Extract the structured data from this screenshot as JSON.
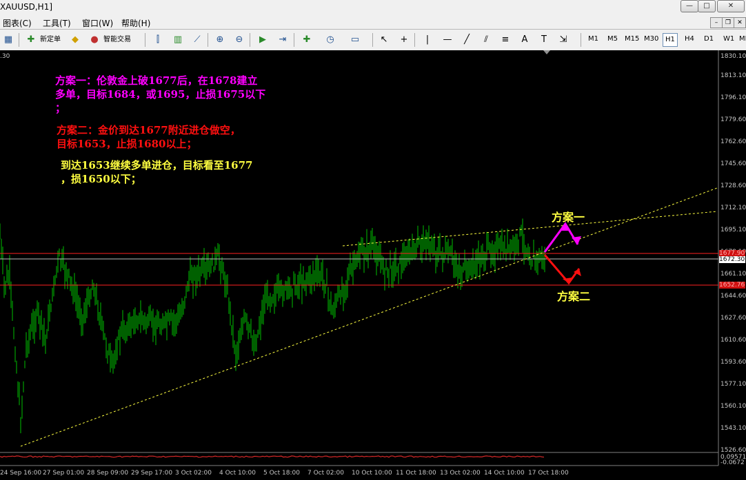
{
  "window": {
    "title": "XAUUSD,H1]"
  },
  "menu": [
    "图表(C)",
    "工具(T)",
    "窗口(W)",
    "帮助(H)"
  ],
  "toolbar": {
    "new_order": "新定单",
    "expert": "智能交易",
    "text_tool": "A",
    "label_tool": "T"
  },
  "timeframes": [
    "M1",
    "M5",
    "M15",
    "M30",
    "H1",
    "H4",
    "D1",
    "W1",
    "MN"
  ],
  "active_timeframe": "H1",
  "chart": {
    "top_left_value": ".30",
    "notes": [
      {
        "text": "方案一：伦敦金上破1677后，在1678建立\n多单，目标1684，或1695，止损1675以下\n；",
        "color": "#ff00ff"
      },
      {
        "text": "方案二：金价到达1677附近进仓做空，\n目标1653，止损1680以上；",
        "color": "#ff1010"
      },
      {
        "text": "到达1653继续多单进仓，目标看至1677\n，损1650以下；",
        "color": "#ffff40"
      }
    ],
    "plan_labels": {
      "plan1": "方案一",
      "plan2": "方案二"
    },
    "price_axis": [
      "1830.10",
      "1813.10",
      "1796.10",
      "1779.60",
      "1762.60",
      "1745.60",
      "1728.60",
      "1712.10",
      "1695.10",
      "1678.10",
      "1661.10",
      "1644.60",
      "1627.60",
      "1610.60",
      "1593.60",
      "1577.10",
      "1560.10",
      "1543.10",
      "1526.60"
    ],
    "price_markers": [
      {
        "value": "1677.90",
        "bg": "#d01010",
        "fg": "#ffb0b0"
      },
      {
        "value": "1672.30",
        "bg": "#ffffff",
        "fg": "#000000"
      },
      {
        "value": "1652.76",
        "bg": "#d01010",
        "fg": "#ffb0b0"
      }
    ],
    "indicator_values": [
      "0.09571",
      "-0.0672"
    ],
    "time_axis": [
      "24 Sep 16:00",
      "27 Sep 01:00",
      "28 Sep 09:00",
      "29 Sep 17:00",
      "3 Oct 02:00",
      "4 Oct 10:00",
      "5 Oct 18:00",
      "7 Oct 02:00",
      "10 Oct 10:00",
      "11 Oct 18:00",
      "13 Oct 02:00",
      "14 Oct 10:00",
      "17 Oct 18:00"
    ],
    "colors": {
      "candle": "#00c000",
      "trendline": "#ffff40",
      "hline_red": "#ff2020",
      "hline_white": "#c0c0c0",
      "plan1_arrow": "#ff00ff",
      "plan2_arrow": "#ff1010"
    }
  }
}
